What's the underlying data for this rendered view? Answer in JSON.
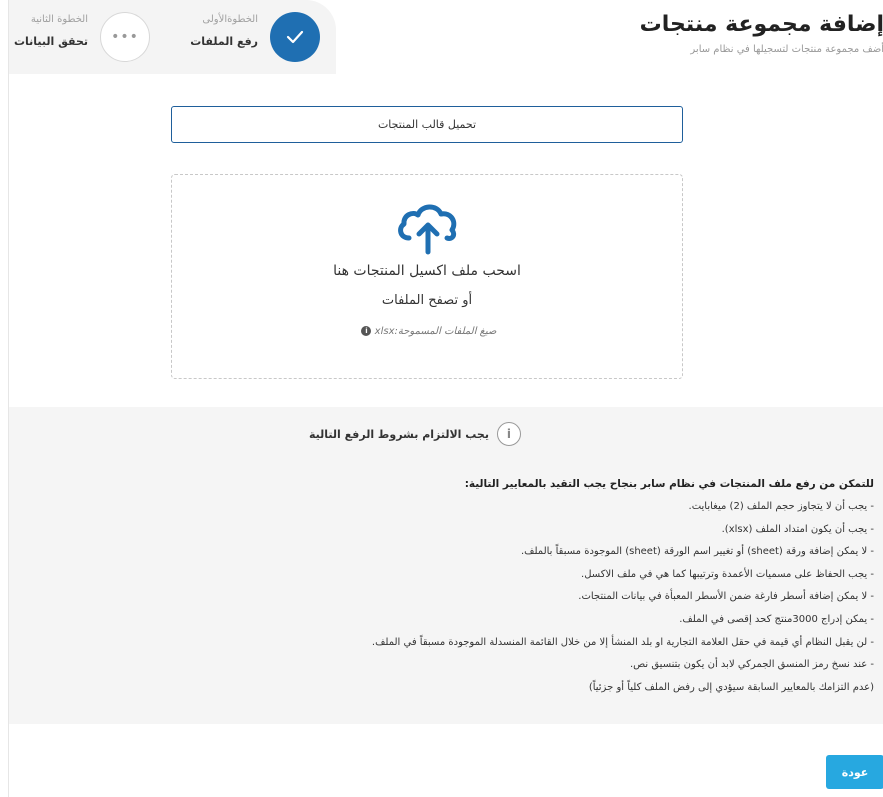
{
  "header": {
    "title": "إضافة مجموعة منتجات",
    "subtitle": "أضف مجموعة منتجات لتسجيلها في نظام سابر"
  },
  "steps": [
    {
      "label": "الخطوةالأولى",
      "value": "رفع الملفات",
      "status": "done",
      "icon": "check-icon"
    },
    {
      "label": "الخطوة الثانية",
      "value": "تحقق البيانات",
      "status": "pending",
      "icon": "ellipsis-icon",
      "glyph": "•••"
    }
  ],
  "template_button": {
    "label": "تحميل قالب المنتجات"
  },
  "dropzone": {
    "icon": "cloud-upload-icon",
    "main_text": "اسحب ملف اكسيل المنتجات هنا",
    "browse_text": "أو تصفح الملفات",
    "formats_text": "صيغ الملفات المسموحة:xlsx"
  },
  "rules": {
    "title": "يجب الالتزام بشروط الرفع التالية",
    "intro": "للتمكن من رفع ملف المنتجات في نظام سابر بنجاح يجب التقيد بالمعايير التالية:",
    "items": [
      "- يجب أن لا يتجاوز حجم الملف (2) ميغابايت.",
      "- يجب أن يكون امتداد الملف (xlsx).",
      "- لا يمكن إضافة ورقة (sheet) أو تغيير اسم الورقة (sheet) الموجودة مسبقاً بالملف.",
      "- يجب الحفاظ على مسميات الأعمدة وترتيبها كما هي في ملف الاكسل.",
      "- لا يمكن إضافة أسطر فارغة ضمن الأسطر المعبأة في بيانات المنتجات.",
      "- يمكن إدراج 3000منتج كحد إقصى في الملف.",
      "- لن يقبل النظام أي قيمة في حقل العلامة التجارية او بلد المنشأ إلا من خلال القائمة المنسدلة الموجودة مسبقاً في الملف.",
      "- عند نسخ رمز المنسق الجمركي لابد أن يكون بتنسيق نص.",
      "(عدم التزامك بالمعايير السابقة سيؤدي إلى رفض الملف كلياً أو جزئياً)"
    ]
  },
  "footer": {
    "back_label": "عودة"
  },
  "colors": {
    "primary": "#1f6fb2",
    "accent": "#27a8e0",
    "border": "#1f5f9b"
  }
}
